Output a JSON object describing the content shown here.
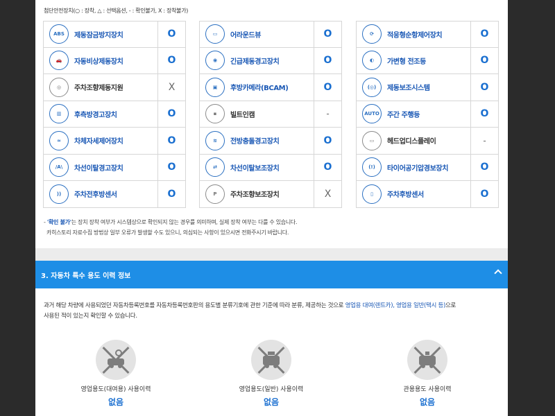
{
  "legend": "첨단안전장치(○ : 장착, △ : 선택옵션, - : 확인불가, X : 장착불가)",
  "columns": [
    [
      {
        "icon": "abs-icon",
        "icon_text": "ABS",
        "name": "제동잠금방지장치",
        "status": "O",
        "g": false
      },
      {
        "icon": "car-front-icon",
        "icon_text": "🚗",
        "name": "자동비상제동장치",
        "status": "O",
        "g": false
      },
      {
        "icon": "steering-icon",
        "icon_text": "◎",
        "name": "주차조향제동지원",
        "status": "X",
        "g": true
      },
      {
        "icon": "rear-warning-icon",
        "icon_text": "▥",
        "name": "후측방경고장치",
        "status": "O",
        "g": false
      },
      {
        "icon": "stability-icon",
        "icon_text": "≈",
        "name": "차체자세제어장치",
        "status": "O",
        "g": false
      },
      {
        "icon": "lane-departure-icon",
        "icon_text": "/A\\",
        "name": "차선이탈경고장치",
        "status": "O",
        "g": false
      },
      {
        "icon": "parking-sensor-icon",
        "icon_text": "))",
        "name": "주차전후방센서",
        "status": "O",
        "g": false
      }
    ],
    [
      {
        "icon": "around-view-icon",
        "icon_text": "▭",
        "name": "어라운드뷰",
        "status": "O",
        "g": false
      },
      {
        "icon": "emergency-brake-warning-icon",
        "icon_text": "◉",
        "name": "긴급제동경고장치",
        "status": "O",
        "g": false
      },
      {
        "icon": "rear-camera-icon",
        "icon_text": "▣",
        "name": "후방카메라(BCAM)",
        "status": "O",
        "g": false
      },
      {
        "icon": "builtin-cam-icon",
        "icon_text": "▪",
        "name": "빌트인캠",
        "status": "-",
        "g": true
      },
      {
        "icon": "forward-collision-icon",
        "icon_text": "≋",
        "name": "전방충돌경고장치",
        "status": "O",
        "g": false
      },
      {
        "icon": "lane-keep-icon",
        "icon_text": "⇄",
        "name": "차선이탈보조장치",
        "status": "O",
        "g": false
      },
      {
        "icon": "parking-assist-icon",
        "icon_text": "P",
        "name": "주차조향보조장치",
        "status": "X",
        "g": true
      }
    ],
    [
      {
        "icon": "adaptive-cruise-icon",
        "icon_text": "⟳",
        "name": "적응형순항제어장치",
        "status": "O",
        "g": false
      },
      {
        "icon": "adaptive-headlamp-icon",
        "icon_text": "◐",
        "name": "가변형 전조등",
        "status": "O",
        "g": false
      },
      {
        "icon": "brake-assist-icon",
        "icon_text": "(◎)",
        "name": "제동보조시스템",
        "status": "O",
        "g": false
      },
      {
        "icon": "daytime-light-icon",
        "icon_text": "AUTO",
        "name": "주간 주행등",
        "status": "O",
        "g": false
      },
      {
        "icon": "hud-icon",
        "icon_text": "▭",
        "name": "헤드업디스플레이",
        "status": "-",
        "g": true
      },
      {
        "icon": "tire-pressure-icon",
        "icon_text": "(!)",
        "name": "타이어공기압경보장치",
        "status": "O",
        "g": false
      },
      {
        "icon": "rear-sensor-icon",
        "icon_text": "▯",
        "name": "주차후방센서",
        "status": "O",
        "g": false
      }
    ]
  ],
  "note1_prefix": "- ",
  "note1_hl": "'확인 불가'",
  "note1_text": "는 장치 장착 여부가 시스템상으로 확인되지 않는 경우를 의미하며, 실제 장착 여부는 다를 수 있습니다.",
  "note2": "카히스토리 자료수집 방법상 일부 오류가 발생할 수도 있으니, 의심되는 사항이 있으시면 전화주시기 바랍니다.",
  "section_title": "3. 자동차 특수 용도 이력 정보",
  "desc_part1": "과거 해당 차량에 사용되었던 자동차등록번호를 자동차등록번호판의 용도별 분류기호에 관한 기준에 따라 분류, 제공하는 것으로 ",
  "desc_hl": "영업용 대여(렌트카), 영업용 일반(택시 등)",
  "desc_part2": "으로",
  "desc_line2": "사용된 적이 있는지 확인할 수 있습니다.",
  "history": [
    {
      "icon": "rental-car-icon",
      "label": "영업용도(대여용) 사용이력",
      "value": "없음"
    },
    {
      "icon": "taxi-icon",
      "label": "영업용도(일반) 사용이력",
      "value": "없음"
    },
    {
      "icon": "government-car-icon",
      "label": "관용용도 사용이력",
      "value": "없음"
    }
  ]
}
